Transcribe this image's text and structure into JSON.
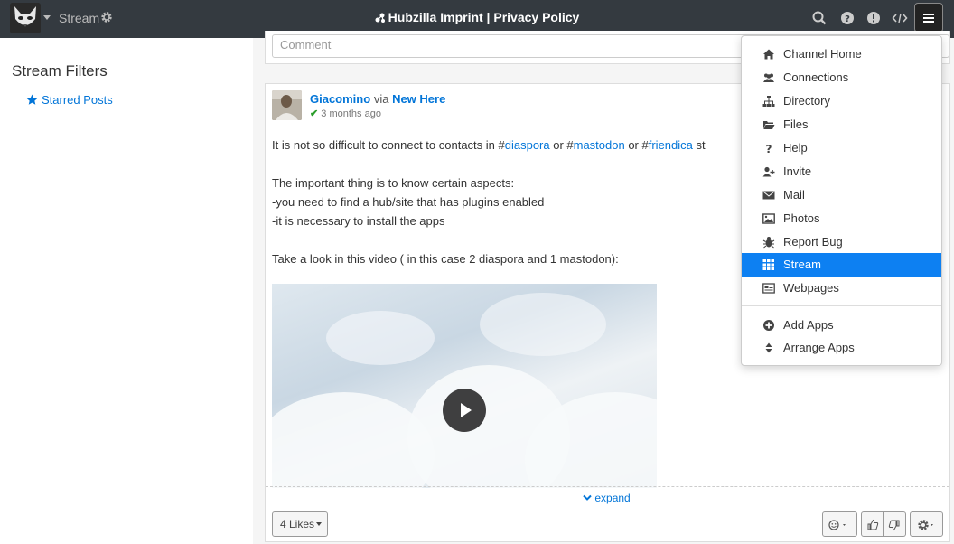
{
  "navbar": {
    "stream_label": "Stream",
    "title": "Hubzilla Imprint | Privacy Policy",
    "icons": [
      "search-icon",
      "help-icon",
      "notifications-icon",
      "code-icon",
      "menu-icon"
    ]
  },
  "sidebar": {
    "title": "Stream Filters",
    "starred_label": "Starred Posts"
  },
  "comment": {
    "placeholder": "Comment"
  },
  "post": {
    "author": "Giacomino",
    "via": "via",
    "group": "New Here",
    "time": "3 months ago",
    "text_line1_pre": "It is not so difficult to connect to contacts in #",
    "tag1": "diaspora",
    "text_or1": " or #",
    "tag2": "mastodon",
    "text_or2": " or #",
    "tag3": "friendica",
    "text_line1_post": " st",
    "line2": "The important thing is to know certain aspects:",
    "line3": "-you need to find a hub/site that has plugins enabled",
    "line4": "-it is necessary to install the apps",
    "line5": "Take a look in this video ( in this case 2 diaspora and 1 mastodon):",
    "expand_label": "expand",
    "likes_label": "4 Likes"
  },
  "menu": {
    "items": [
      {
        "label": "Channel Home",
        "icon": "home-icon"
      },
      {
        "label": "Connections",
        "icon": "users-icon"
      },
      {
        "label": "Directory",
        "icon": "sitemap-icon"
      },
      {
        "label": "Files",
        "icon": "folder-icon"
      },
      {
        "label": "Help",
        "icon": "question-icon"
      },
      {
        "label": "Invite",
        "icon": "user-plus-icon"
      },
      {
        "label": "Mail",
        "icon": "envelope-icon"
      },
      {
        "label": "Photos",
        "icon": "photo-icon"
      },
      {
        "label": "Report Bug",
        "icon": "bug-icon"
      },
      {
        "label": "Stream",
        "icon": "grid-icon",
        "active": true
      },
      {
        "label": "Webpages",
        "icon": "newspaper-icon"
      }
    ],
    "extra": [
      {
        "label": "Add Apps",
        "icon": "plus-circle-icon"
      },
      {
        "label": "Arrange Apps",
        "icon": "sort-icon"
      }
    ]
  },
  "colors": {
    "navbar": "#343a40",
    "link": "#0275d8",
    "active": "#0d80f2"
  }
}
